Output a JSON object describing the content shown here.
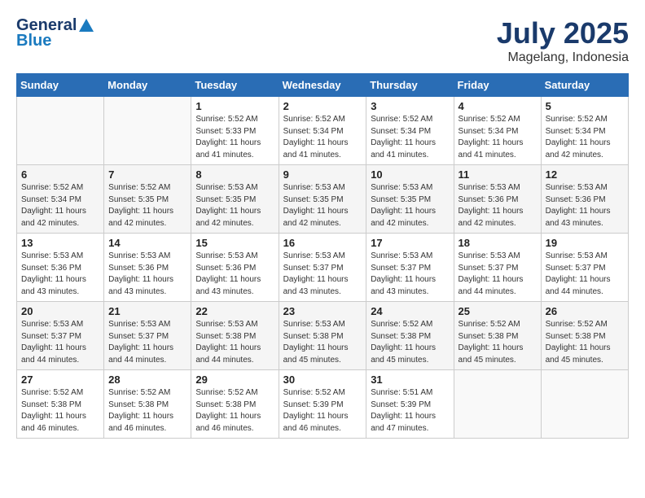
{
  "header": {
    "logo_general": "General",
    "logo_blue": "Blue",
    "month": "July 2025",
    "location": "Magelang, Indonesia"
  },
  "weekdays": [
    "Sunday",
    "Monday",
    "Tuesday",
    "Wednesday",
    "Thursday",
    "Friday",
    "Saturday"
  ],
  "weeks": [
    [
      {
        "day": "",
        "info": ""
      },
      {
        "day": "",
        "info": ""
      },
      {
        "day": "1",
        "info": "Sunrise: 5:52 AM\nSunset: 5:33 PM\nDaylight: 11 hours and 41 minutes."
      },
      {
        "day": "2",
        "info": "Sunrise: 5:52 AM\nSunset: 5:34 PM\nDaylight: 11 hours and 41 minutes."
      },
      {
        "day": "3",
        "info": "Sunrise: 5:52 AM\nSunset: 5:34 PM\nDaylight: 11 hours and 41 minutes."
      },
      {
        "day": "4",
        "info": "Sunrise: 5:52 AM\nSunset: 5:34 PM\nDaylight: 11 hours and 41 minutes."
      },
      {
        "day": "5",
        "info": "Sunrise: 5:52 AM\nSunset: 5:34 PM\nDaylight: 11 hours and 42 minutes."
      }
    ],
    [
      {
        "day": "6",
        "info": "Sunrise: 5:52 AM\nSunset: 5:34 PM\nDaylight: 11 hours and 42 minutes."
      },
      {
        "day": "7",
        "info": "Sunrise: 5:52 AM\nSunset: 5:35 PM\nDaylight: 11 hours and 42 minutes."
      },
      {
        "day": "8",
        "info": "Sunrise: 5:53 AM\nSunset: 5:35 PM\nDaylight: 11 hours and 42 minutes."
      },
      {
        "day": "9",
        "info": "Sunrise: 5:53 AM\nSunset: 5:35 PM\nDaylight: 11 hours and 42 minutes."
      },
      {
        "day": "10",
        "info": "Sunrise: 5:53 AM\nSunset: 5:35 PM\nDaylight: 11 hours and 42 minutes."
      },
      {
        "day": "11",
        "info": "Sunrise: 5:53 AM\nSunset: 5:36 PM\nDaylight: 11 hours and 42 minutes."
      },
      {
        "day": "12",
        "info": "Sunrise: 5:53 AM\nSunset: 5:36 PM\nDaylight: 11 hours and 43 minutes."
      }
    ],
    [
      {
        "day": "13",
        "info": "Sunrise: 5:53 AM\nSunset: 5:36 PM\nDaylight: 11 hours and 43 minutes."
      },
      {
        "day": "14",
        "info": "Sunrise: 5:53 AM\nSunset: 5:36 PM\nDaylight: 11 hours and 43 minutes."
      },
      {
        "day": "15",
        "info": "Sunrise: 5:53 AM\nSunset: 5:36 PM\nDaylight: 11 hours and 43 minutes."
      },
      {
        "day": "16",
        "info": "Sunrise: 5:53 AM\nSunset: 5:37 PM\nDaylight: 11 hours and 43 minutes."
      },
      {
        "day": "17",
        "info": "Sunrise: 5:53 AM\nSunset: 5:37 PM\nDaylight: 11 hours and 43 minutes."
      },
      {
        "day": "18",
        "info": "Sunrise: 5:53 AM\nSunset: 5:37 PM\nDaylight: 11 hours and 44 minutes."
      },
      {
        "day": "19",
        "info": "Sunrise: 5:53 AM\nSunset: 5:37 PM\nDaylight: 11 hours and 44 minutes."
      }
    ],
    [
      {
        "day": "20",
        "info": "Sunrise: 5:53 AM\nSunset: 5:37 PM\nDaylight: 11 hours and 44 minutes."
      },
      {
        "day": "21",
        "info": "Sunrise: 5:53 AM\nSunset: 5:37 PM\nDaylight: 11 hours and 44 minutes."
      },
      {
        "day": "22",
        "info": "Sunrise: 5:53 AM\nSunset: 5:38 PM\nDaylight: 11 hours and 44 minutes."
      },
      {
        "day": "23",
        "info": "Sunrise: 5:53 AM\nSunset: 5:38 PM\nDaylight: 11 hours and 45 minutes."
      },
      {
        "day": "24",
        "info": "Sunrise: 5:52 AM\nSunset: 5:38 PM\nDaylight: 11 hours and 45 minutes."
      },
      {
        "day": "25",
        "info": "Sunrise: 5:52 AM\nSunset: 5:38 PM\nDaylight: 11 hours and 45 minutes."
      },
      {
        "day": "26",
        "info": "Sunrise: 5:52 AM\nSunset: 5:38 PM\nDaylight: 11 hours and 45 minutes."
      }
    ],
    [
      {
        "day": "27",
        "info": "Sunrise: 5:52 AM\nSunset: 5:38 PM\nDaylight: 11 hours and 46 minutes."
      },
      {
        "day": "28",
        "info": "Sunrise: 5:52 AM\nSunset: 5:38 PM\nDaylight: 11 hours and 46 minutes."
      },
      {
        "day": "29",
        "info": "Sunrise: 5:52 AM\nSunset: 5:38 PM\nDaylight: 11 hours and 46 minutes."
      },
      {
        "day": "30",
        "info": "Sunrise: 5:52 AM\nSunset: 5:39 PM\nDaylight: 11 hours and 46 minutes."
      },
      {
        "day": "31",
        "info": "Sunrise: 5:51 AM\nSunset: 5:39 PM\nDaylight: 11 hours and 47 minutes."
      },
      {
        "day": "",
        "info": ""
      },
      {
        "day": "",
        "info": ""
      }
    ]
  ]
}
